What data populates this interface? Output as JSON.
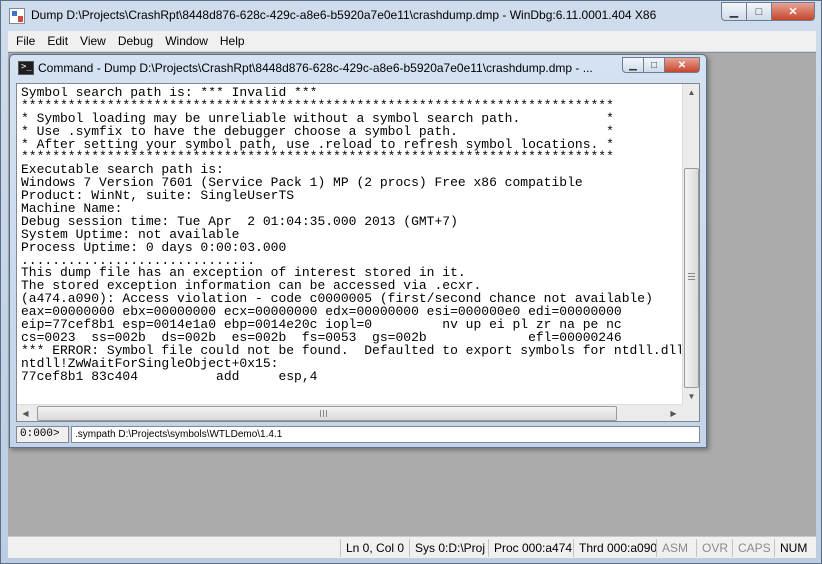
{
  "window": {
    "title": "Dump D:\\Projects\\CrashRpt\\8448d876-628c-429c-a8e6-b5920a7e0e11\\crashdump.dmp - WinDbg:6.11.0001.404 X86",
    "minimize_glyph": "▁",
    "maximize_glyph": "□",
    "close_glyph": "✕"
  },
  "menu": [
    {
      "label": "File"
    },
    {
      "label": "Edit"
    },
    {
      "label": "View"
    },
    {
      "label": "Debug"
    },
    {
      "label": "Window"
    },
    {
      "label": "Help"
    }
  ],
  "command_window": {
    "title": "Command - Dump D:\\Projects\\CrashRpt\\8448d876-628c-429c-a8e6-b5920a7e0e11\\crashdump.dmp - ...",
    "icon_glyph": ">_",
    "output_lines": [
      "Symbol search path is: *** Invalid ***",
      "****************************************************************************",
      "* Symbol loading may be unreliable without a symbol search path.           *",
      "* Use .symfix to have the debugger choose a symbol path.                   *",
      "* After setting your symbol path, use .reload to refresh symbol locations. *",
      "****************************************************************************",
      "Executable search path is:",
      "Windows 7 Version 7601 (Service Pack 1) MP (2 procs) Free x86 compatible",
      "Product: WinNt, suite: SingleUserTS",
      "Machine Name:",
      "Debug session time: Tue Apr  2 01:04:35.000 2013 (GMT+7)",
      "System Uptime: not available",
      "Process Uptime: 0 days 0:00:03.000",
      "..............................",
      "This dump file has an exception of interest stored in it.",
      "The stored exception information can be accessed via .ecxr.",
      "(a474.a090): Access violation - code c0000005 (first/second chance not available)",
      "eax=00000000 ebx=00000000 ecx=00000000 edx=00000000 esi=000000e0 edi=00000000",
      "eip=77cef8b1 esp=0014e1a0 ebp=0014e20c iopl=0         nv up ei pl zr na pe nc",
      "cs=0023  ss=002b  ds=002b  es=002b  fs=0053  gs=002b             efl=00000246",
      "*** ERROR: Symbol file could not be found.  Defaulted to export symbols for ntdll.dll -",
      "ntdll!ZwWaitForSingleObject+0x15:",
      "77cef8b1 83c404          add     esp,4"
    ],
    "prompt": "0:000>",
    "command_value": ".sympath D:\\Projects\\symbols\\WTLDemo\\1.4.1"
  },
  "status_bar": [
    {
      "text": "Ln 0, Col 0",
      "dim": false
    },
    {
      "text": "Sys 0:D:\\Proj",
      "dim": false
    },
    {
      "text": "Proc 000:a474",
      "dim": false
    },
    {
      "text": "Thrd 000:a090",
      "dim": false
    },
    {
      "text": "ASM",
      "dim": true
    },
    {
      "text": "OVR",
      "dim": true
    },
    {
      "text": "CAPS",
      "dim": true
    },
    {
      "text": "NUM",
      "dim": false
    }
  ]
}
